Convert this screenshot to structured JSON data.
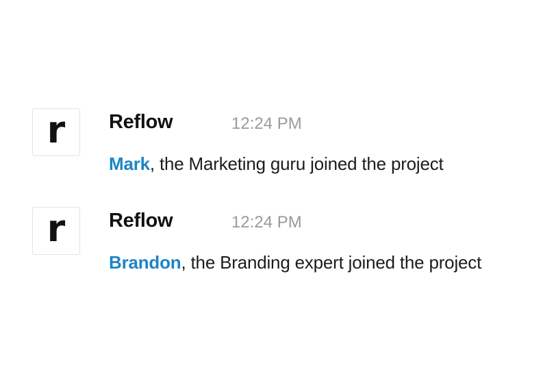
{
  "messages": [
    {
      "avatar_letter": "r",
      "sender": "Reflow",
      "time": "12:24 PM",
      "mention": "Mark",
      "text": ", the Marketing guru joined the project"
    },
    {
      "avatar_letter": "r",
      "sender": "Reflow",
      "time": "12:24 PM",
      "mention": "Brandon",
      "text": ", the Branding expert joined the project"
    }
  ],
  "colors": {
    "mention": "#1d84c6",
    "timestamp": "#9a9a9a",
    "text": "#1d1c1d"
  }
}
